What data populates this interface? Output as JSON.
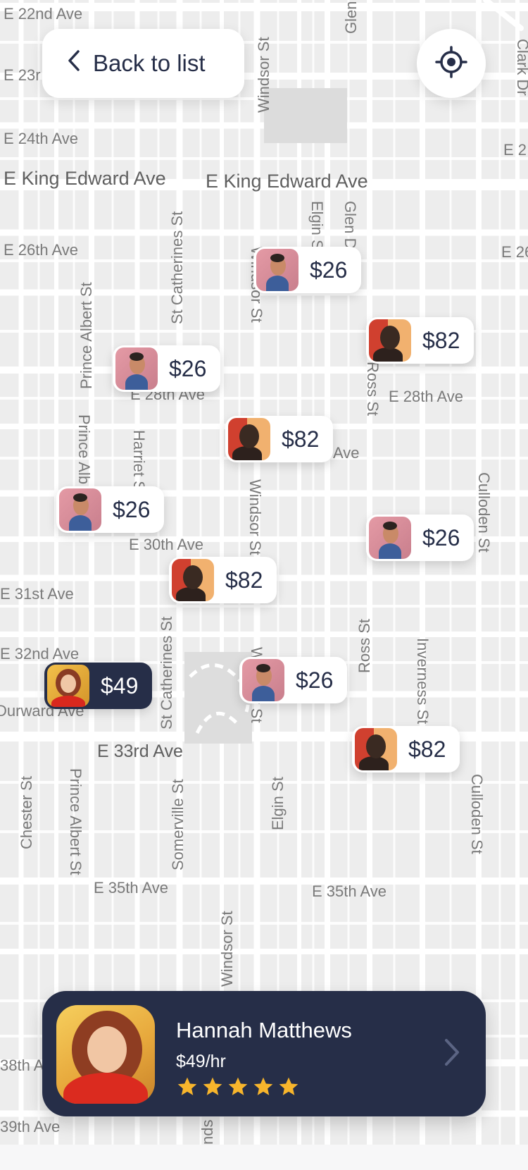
{
  "header": {
    "back_label": "Back to list",
    "locate_icon": "crosshair-icon"
  },
  "map": {
    "streets": [
      "E 22nd Ave",
      "E 23r",
      "E 24th Ave",
      "E 2",
      "E King Edward Ave",
      "E King Edward Ave",
      "E 26th Ave",
      "E 26",
      "E 28th Ave",
      "E 28th Ave",
      "Ave",
      "E 30th Ave",
      "E 31st Ave",
      "E 32nd Ave",
      "Durward Ave",
      "E 33rd Ave",
      "E 35th Ave",
      "E 35th Ave",
      "38th A",
      "39th Ave",
      "Windsor St",
      "Glen",
      "Clark Dr",
      "St Catherines St",
      "Prince Albert St",
      "Elgin St",
      "Glen Dr",
      "Windsor St",
      "Ross St",
      "Prince Alb",
      "Harriet St",
      "Windsor St",
      "Culloden St",
      "St Catherines St",
      "Windsor St",
      "Ross St",
      "Inverness St",
      "Chester St",
      "Prince Albert St",
      "Somerville St",
      "Elgin St",
      "Culloden St",
      "Windsor St",
      "nds"
    ]
  },
  "pins": [
    {
      "price": "$26",
      "thumb": "man-pink",
      "active": false
    },
    {
      "price": "$82",
      "thumb": "man-orange",
      "active": false
    },
    {
      "price": "$26",
      "thumb": "man-pink",
      "active": false
    },
    {
      "price": "$82",
      "thumb": "man-orange",
      "active": false
    },
    {
      "price": "$26",
      "thumb": "man-pink",
      "active": false
    },
    {
      "price": "$26",
      "thumb": "man-pink",
      "active": false
    },
    {
      "price": "$82",
      "thumb": "man-orange",
      "active": false
    },
    {
      "price": "$49",
      "thumb": "woman",
      "active": true
    },
    {
      "price": "$26",
      "thumb": "man-pink",
      "active": false
    },
    {
      "price": "$82",
      "thumb": "man-orange",
      "active": false
    }
  ],
  "card": {
    "name": "Hannah Matthews",
    "rate": "$49/hr",
    "rating": 5,
    "star_color": "#f7b52c"
  },
  "colors": {
    "primary": "#262e48",
    "surface": "#ffffff",
    "map_bg": "#ededed"
  }
}
